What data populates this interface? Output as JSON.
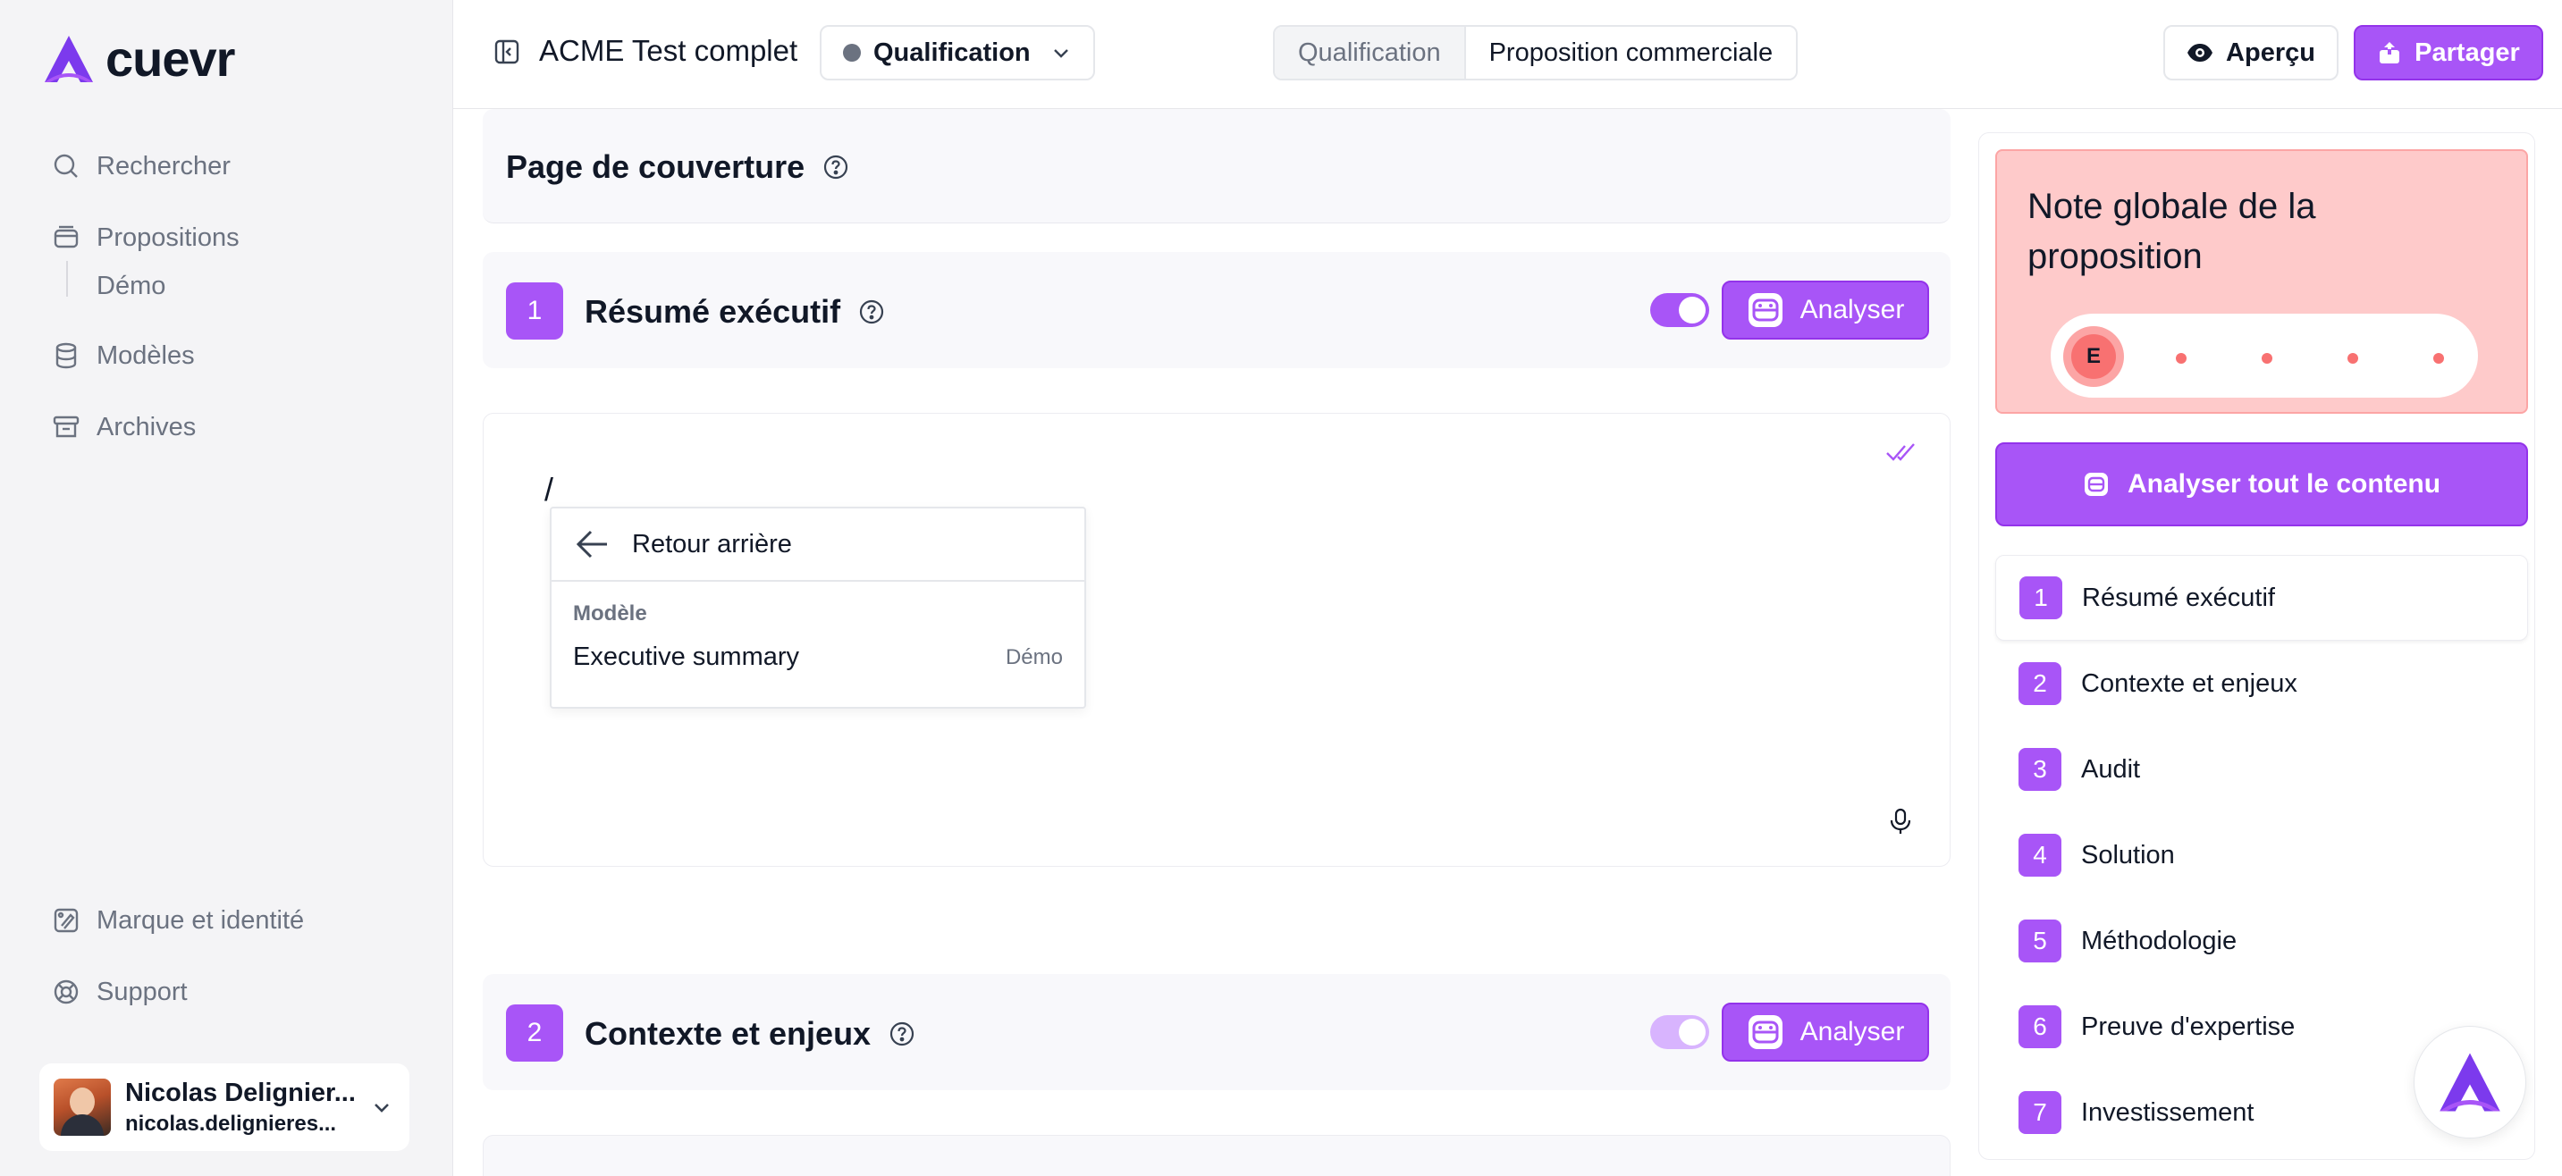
{
  "app": {
    "logo_text": "cuevr"
  },
  "sidebar": {
    "nav": [
      {
        "label": "Rechercher",
        "icon": "search-icon"
      },
      {
        "label": "Propositions",
        "icon": "folder-icon"
      },
      {
        "label": "Démo",
        "icon": ""
      },
      {
        "label": "Modèles",
        "icon": "database-icon"
      },
      {
        "label": "Archives",
        "icon": "archive-icon"
      }
    ],
    "bottom": [
      {
        "label": "Marque et identité",
        "icon": "brand-icon"
      },
      {
        "label": "Support",
        "icon": "lifebuoy-icon"
      }
    ],
    "user": {
      "name": "Nicolas Delignier...",
      "email": "nicolas.delignieres..."
    }
  },
  "topbar": {
    "doc_title": "ACME Test complet",
    "status_label": "Qualification",
    "segments": [
      "Qualification",
      "Proposition commerciale"
    ],
    "preview_label": "Aperçu",
    "share_label": "Partager"
  },
  "main": {
    "cover_title": "Page de couverture",
    "sections": [
      {
        "num": "1",
        "title": "Résumé exécutif",
        "analyze_label": "Analyser"
      },
      {
        "num": "2",
        "title": "Contexte et enjeux",
        "analyze_label": "Analyser"
      }
    ],
    "editor": {
      "text": "/",
      "dropdown": {
        "back_label": "Retour arrière",
        "group_label": "Modèle",
        "item_label": "Executive summary",
        "item_tag": "Démo"
      }
    }
  },
  "rpanel": {
    "score_title": "Note globale de la proposition",
    "grade": "E",
    "analyze_all_label": "Analyser tout le contenu",
    "toc": [
      {
        "num": "1",
        "label": "Résumé exécutif"
      },
      {
        "num": "2",
        "label": "Contexte et enjeux"
      },
      {
        "num": "3",
        "label": "Audit"
      },
      {
        "num": "4",
        "label": "Solution"
      },
      {
        "num": "5",
        "label": "Méthodologie"
      },
      {
        "num": "6",
        "label": "Preuve d'expertise"
      },
      {
        "num": "7",
        "label": "Investissement"
      }
    ]
  },
  "colors": {
    "accent": "#a855f7",
    "grade_bg": "#fecaca",
    "grade_dot": "#f87171"
  }
}
